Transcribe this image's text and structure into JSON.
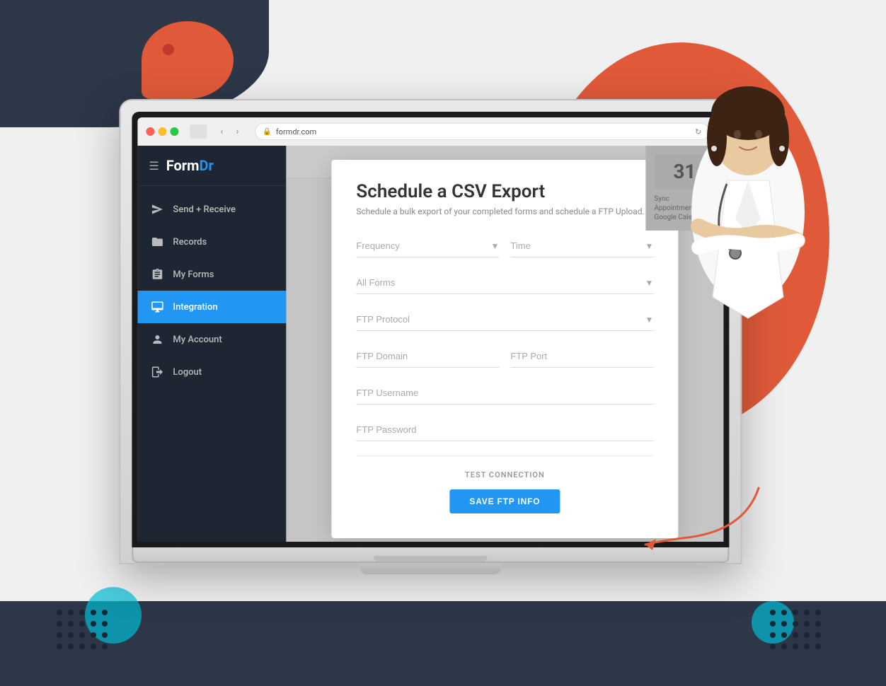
{
  "page": {
    "title": "FormDr - Schedule CSV Export"
  },
  "background": {
    "blob_color": "#2d3748",
    "orange_color": "#e05a3a"
  },
  "browser": {
    "url": "formdr.com",
    "lock_symbol": "🔒"
  },
  "sidebar": {
    "logo_form": "Form",
    "logo_dr": "Dr",
    "nav_items": [
      {
        "id": "send-receive",
        "label": "Send + Receive",
        "icon": "send"
      },
      {
        "id": "records",
        "label": "Records",
        "icon": "folder"
      },
      {
        "id": "my-forms",
        "label": "My Forms",
        "icon": "forms"
      },
      {
        "id": "integration",
        "label": "Integration",
        "icon": "monitor",
        "active": true
      },
      {
        "id": "my-account",
        "label": "My Account",
        "icon": "account"
      },
      {
        "id": "logout",
        "label": "Logout",
        "icon": "logout"
      }
    ]
  },
  "topbar": {
    "account_label": "My Account"
  },
  "modal": {
    "title": "Schedule a CSV Export",
    "subtitle": "Schedule a bulk export of your completed forms and schedule a FTP Upload.",
    "frequency_placeholder": "Frequency",
    "time_placeholder": "Time",
    "all_forms_placeholder": "All Forms",
    "ftp_protocol_placeholder": "FTP Protocol",
    "ftp_domain_placeholder": "FTP Domain",
    "ftp_port_placeholder": "FTP Port",
    "ftp_username_placeholder": "FTP Username",
    "ftp_password_placeholder": "FTP Password",
    "test_connection_label": "TEST CONNECTION",
    "save_button_label": "SAVE FTP INFO"
  },
  "calendar": {
    "number": "31",
    "sync_text": "Sync Appointments with Google Calendar"
  }
}
